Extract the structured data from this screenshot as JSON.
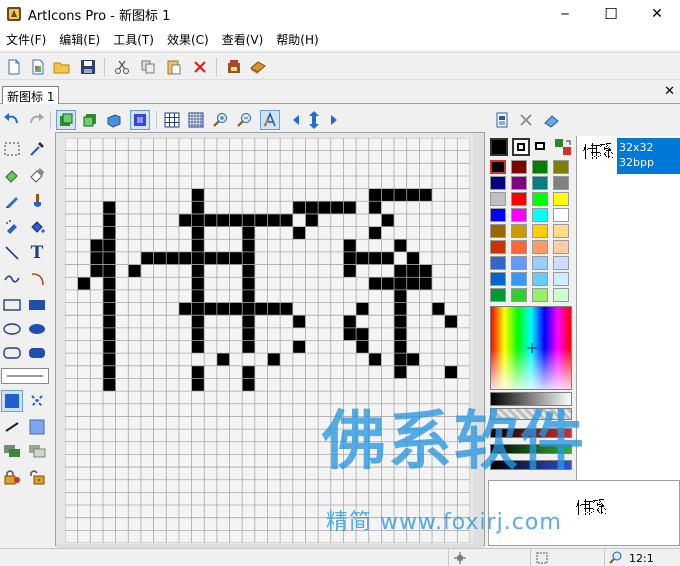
{
  "window": {
    "title": "ArtIcons Pro - 新图标 1",
    "minimize_glyph": "─",
    "maximize_glyph": "☐",
    "close_glyph": "✕"
  },
  "menu": [
    "文件(F)",
    "编辑(E)",
    "工具(T)",
    "效果(C)",
    "查看(V)",
    "帮助(H)"
  ],
  "toolbar1_icons": [
    "new-file-icon",
    "new-from-image-icon",
    "open-folder-icon",
    "save-icon",
    "cut-icon",
    "copy-icon",
    "paste-icon",
    "delete-icon",
    "extract-icon",
    "library-icon"
  ],
  "document": {
    "tab_label": "新图标 1",
    "close_glyph": "✕"
  },
  "toolbar2_icons": [
    "undo-icon",
    "redo-icon",
    "layer-up-icon",
    "layer-down-icon",
    "layer-3d-icon",
    "background-icon",
    "grid-icon",
    "grid-fine-icon",
    "zoom-in-icon",
    "zoom-out-icon",
    "text-antialias-icon",
    "arrow-left-icon",
    "arrow-move-icon",
    "arrow-right-icon"
  ],
  "tools": [
    "rect-select-icon",
    "eyedropper-icon",
    "eraser-icon",
    "color-eraser-icon",
    "pencil-icon",
    "brush-icon",
    "airbrush-icon",
    "fill-bucket-icon",
    "line-icon",
    "text-icon",
    "curve-icon",
    "arc-icon",
    "rect-outline-icon",
    "rect-filled-icon",
    "ellipse-outline-icon",
    "ellipse-filled-icon",
    "roundrect-outline-icon",
    "roundrect-filled-icon"
  ],
  "text_tool_glyph": "T",
  "canvas": {
    "size": 32,
    "pixel_rows": [
      "................................",
      "................................",
      "................................",
      "................................",
      "..........#.............#####...",
      "...#......#.......#####.#.......",
      "...#.....#########.#.....#......",
      "...#......#...#...#.....#.......",
      "..##......#...#.......#...#.....",
      "..##..#########.......####.#....",
      "..##.#....#...#.......#...###...",
      ".#.#......#...#.........#####...",
      "...#......#...#...........#.....",
      "...#.....#########.....#..#..#..",
      "...#......#...#...#...#...#...#.",
      "...#......#...#.......##..#.....",
      "...#......#...#...#....#..#.....",
      "...#........#...#.......#.##....",
      "...#......#...#...........#...#.",
      "...#......#...#.................",
      "................................",
      "................................",
      "................................",
      "................................",
      "................................",
      "................................",
      "................................",
      "................................",
      "................................",
      "................................",
      "................................",
      "................................"
    ]
  },
  "right_toolbar_icons": [
    "image-format-icon",
    "delete-format-icon",
    "eraser-format-icon"
  ],
  "palette": {
    "primary": "#000000",
    "secondary": "#ffffff",
    "swatches": [
      [
        "#000000",
        "#800000",
        "#008000",
        "#808000"
      ],
      [
        "#000080",
        "#800080",
        "#008080",
        "#808080"
      ],
      [
        "#c0c0c0",
        "#ff0000",
        "#00ff00",
        "#ffff00"
      ],
      [
        "#0000ff",
        "#ff00ff",
        "#00ffff",
        "#ffffff"
      ],
      [
        "#996600",
        "#cc9900",
        "#ffcc00",
        "#ffdd88"
      ],
      [
        "#cc3300",
        "#ff6633",
        "#ff9966",
        "#ffccaa"
      ],
      [
        "#3366cc",
        "#6699ff",
        "#99ccff",
        "#ccddff"
      ],
      [
        "#0066cc",
        "#3399ff",
        "#66ccff",
        "#cceeff"
      ],
      [
        "#009933",
        "#33cc33",
        "#99ee66",
        "#ccffcc"
      ]
    ]
  },
  "formats": {
    "selected_line1": "32x32",
    "selected_line2": "32bpp"
  },
  "preview_alt": "佛系",
  "status": {
    "zoom": "12:1"
  },
  "watermark": {
    "big_text": "佛系软件",
    "small_text": "精简 www.foxirj.com"
  }
}
